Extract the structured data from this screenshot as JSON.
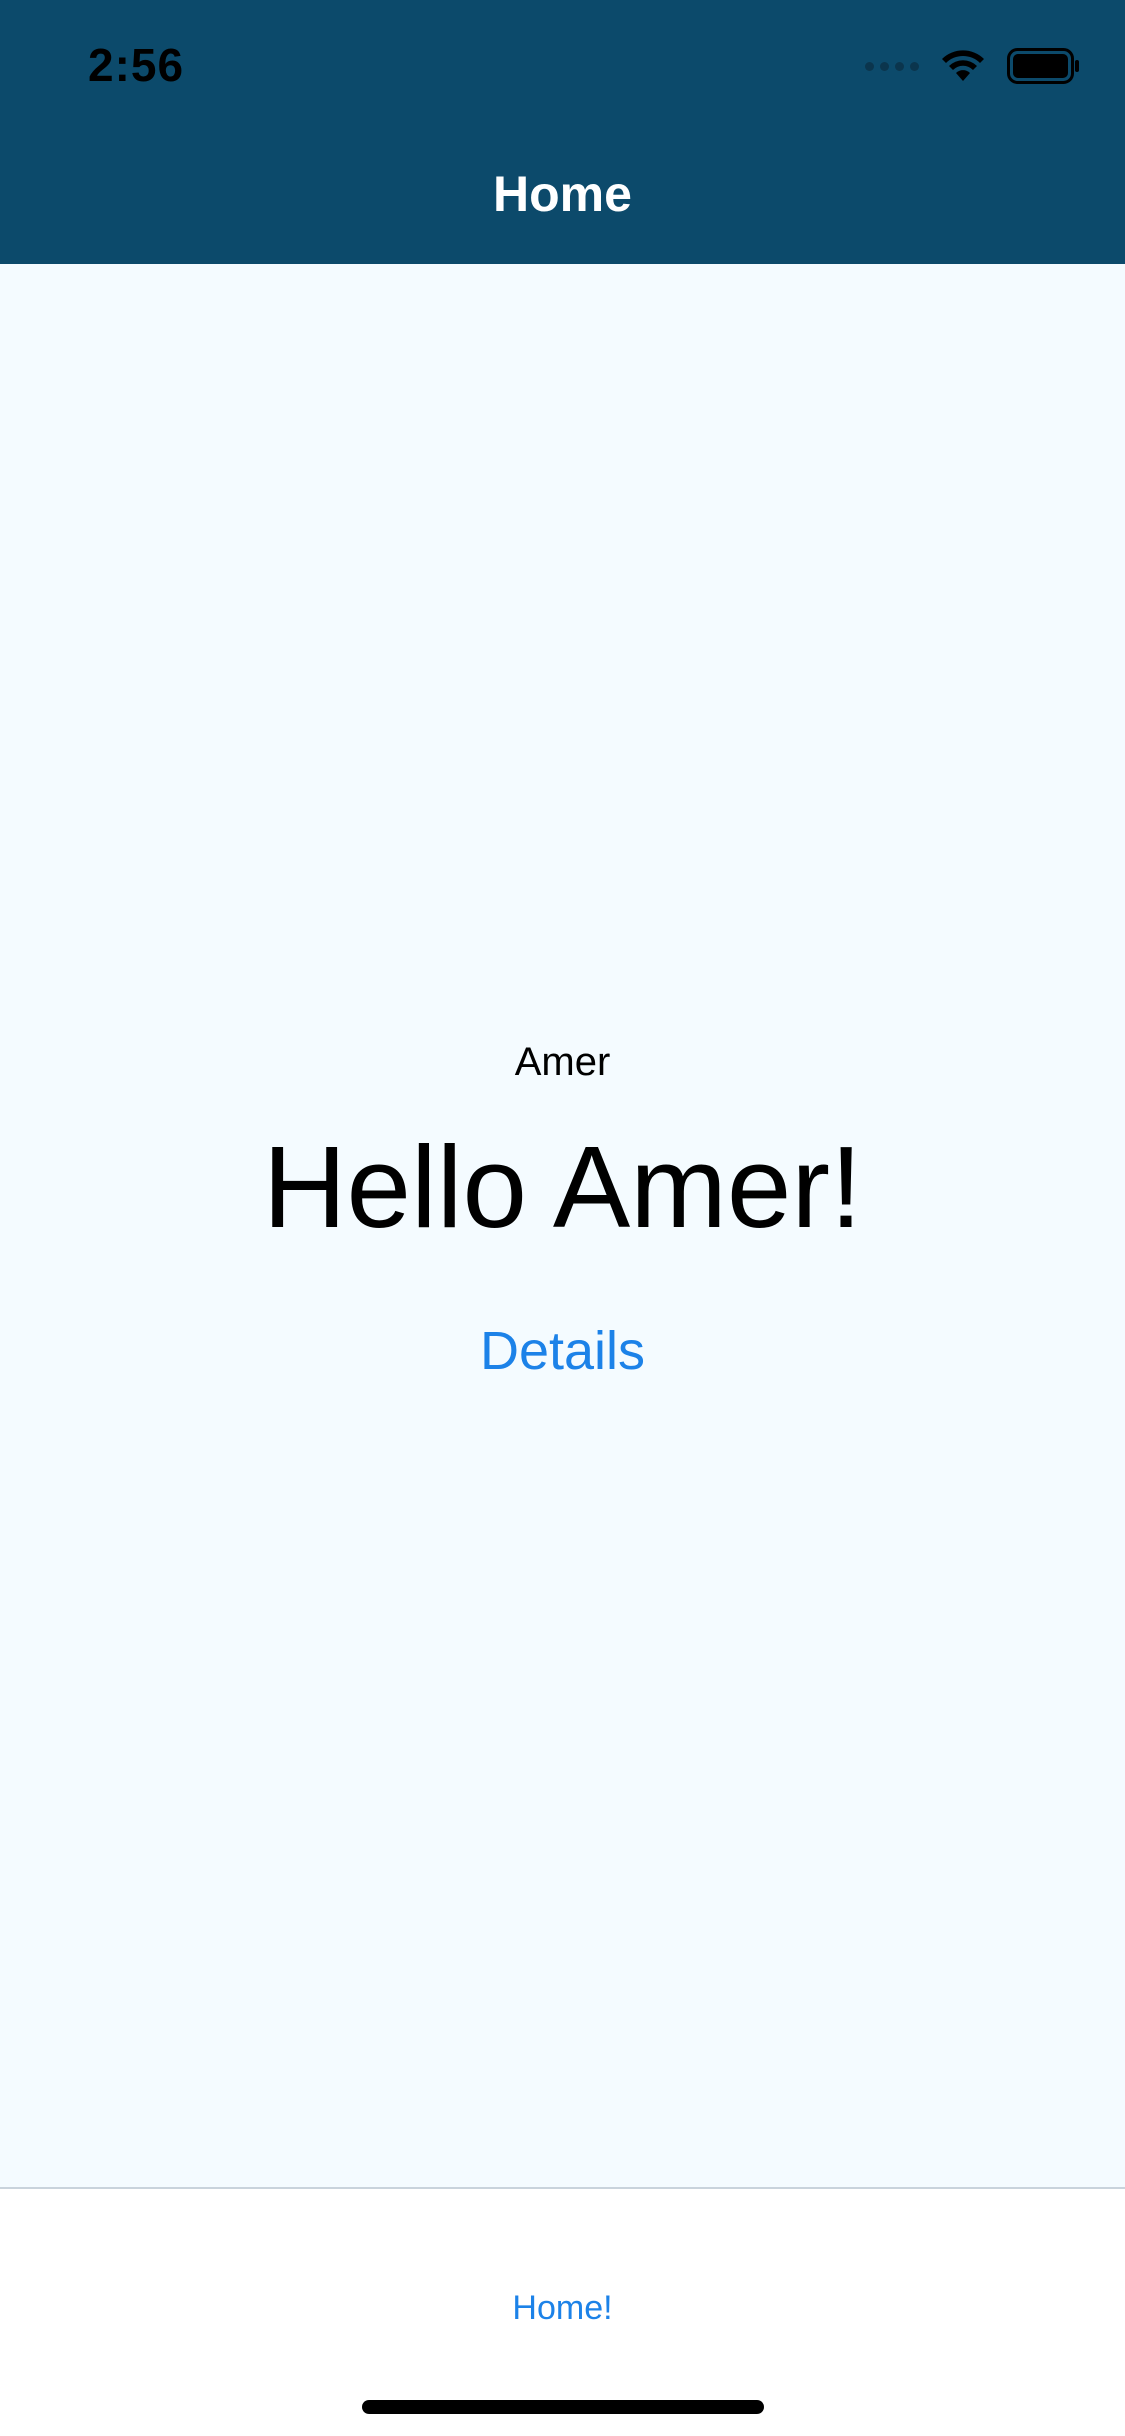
{
  "status_bar": {
    "time": "2:56",
    "icons": [
      "cellular-signal-icon",
      "wifi-icon",
      "battery-icon"
    ]
  },
  "header": {
    "title": "Home",
    "background_color": "#0c4a6b"
  },
  "main": {
    "name_label": "Amer",
    "greeting": "Hello Amer!",
    "details_link": "Details",
    "background_color": "#f4fbff",
    "link_color": "#1c82e8"
  },
  "tab_bar": {
    "items": [
      {
        "label": "Home!"
      }
    ]
  }
}
